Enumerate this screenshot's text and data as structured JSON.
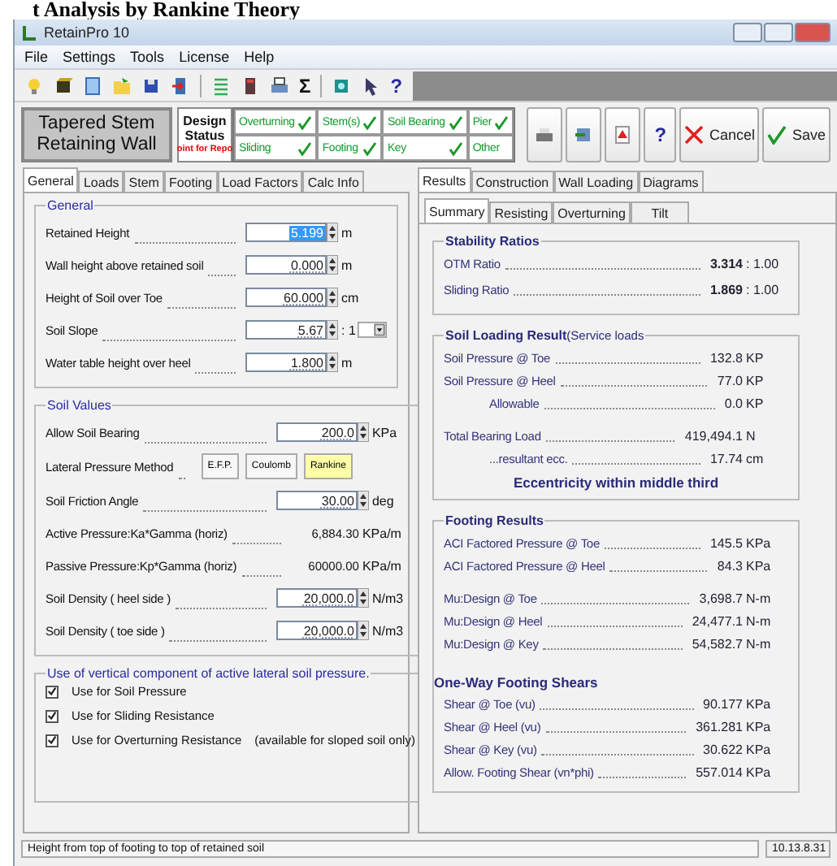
{
  "heading": "t Analysis by Rankine Theory",
  "window": {
    "title": "RetainPro 10"
  },
  "menu": [
    "File",
    "Settings",
    "Tools",
    "License",
    "Help"
  ],
  "toolbar": [
    {
      "kind": "bulb"
    },
    {
      "kind": "box"
    },
    {
      "kind": "doc"
    },
    {
      "kind": "folder"
    },
    {
      "kind": "save"
    },
    {
      "kind": "exit"
    },
    {
      "kind": "sep"
    },
    {
      "kind": "list"
    },
    {
      "kind": "calc"
    },
    {
      "kind": "print"
    },
    {
      "kind": "glyph",
      "text": "Σ"
    },
    {
      "kind": "sep"
    },
    {
      "kind": "book"
    },
    {
      "kind": "pointer"
    },
    {
      "kind": "glyph",
      "text": "?"
    }
  ],
  "wall_type": [
    "Tapered Stem",
    "Retaining Wall"
  ],
  "design_status": {
    "lines": [
      "Design",
      "Status"
    ],
    "note": "oint for Repo"
  },
  "status_checks": [
    {
      "label": "Overturning",
      "ok": true
    },
    {
      "label": "Stem(s)",
      "ok": true
    },
    {
      "label": "Soil Bearing",
      "ok": true
    },
    {
      "label": "Pier",
      "ok": true
    },
    {
      "label": "Sliding",
      "ok": true
    },
    {
      "label": "Footing",
      "ok": true
    },
    {
      "label": "Key",
      "ok": true
    },
    {
      "label": "Other",
      "ok": false
    }
  ],
  "actions": [
    {
      "kind": "print"
    },
    {
      "kind": "export"
    },
    {
      "kind": "pdf"
    },
    {
      "kind": "help",
      "text": "?"
    },
    {
      "kind": "cancel",
      "text": "Cancel"
    },
    {
      "kind": "save",
      "text": "Save"
    }
  ],
  "left_tabs": [
    {
      "label": "General",
      "selected": true
    },
    {
      "label": "Loads",
      "selected": false
    },
    {
      "label": "Stem",
      "selected": false
    },
    {
      "label": "Footing",
      "selected": false
    },
    {
      "label": "Load Factors",
      "selected": false
    },
    {
      "label": "Calc Info",
      "selected": false
    }
  ],
  "general": {
    "title": "General",
    "rows": [
      {
        "kind": "spin",
        "label": "Retained Height",
        "value": "5.199",
        "unit": "m",
        "selected": true
      },
      {
        "kind": "spin",
        "label": "Wall height above retained soil",
        "value": "0.000",
        "unit": "m",
        "selected": false
      },
      {
        "kind": "spin",
        "label": "Height of Soil over Toe",
        "value": "60.000",
        "unit": "cm",
        "selected": false
      },
      {
        "kind": "slope",
        "label": "Soil Slope",
        "value": "5.67",
        "unit": ": 1",
        "selected": false
      },
      {
        "kind": "spin",
        "label": "Water table height over heel",
        "value": "1.800",
        "unit": "m",
        "selected": false
      }
    ]
  },
  "soil_values": {
    "title": "Soil Values",
    "rows": [
      {
        "kind": "spin",
        "label": "Allow Soil Bearing",
        "value": "200.0",
        "unit": "KPa",
        "selected": false
      },
      {
        "kind": "method",
        "label": "Lateral Pressure Method",
        "options": [
          {
            "label": "E.F.P.",
            "selected": false
          },
          {
            "label": "Coulomb",
            "selected": false
          },
          {
            "label": "Rankine",
            "selected": true
          }
        ]
      },
      {
        "kind": "spin",
        "label": "Soil Friction Angle",
        "value": "30.00",
        "unit": "deg",
        "selected": false
      },
      {
        "kind": "readonly",
        "label": "Active Pressure:Ka*Gamma (horiz)",
        "value": "6,884.30",
        "unit": "KPa/m"
      },
      {
        "kind": "readonly",
        "label": "Passive Pressure:Kp*Gamma (horiz)",
        "value": "60000.00",
        "unit": "KPa/m"
      },
      {
        "kind": "spin",
        "label": "Soil Density ( heel side )",
        "value": "20,000.0",
        "unit": "N/m3",
        "selected": false
      },
      {
        "kind": "spin",
        "label": "Soil Density ( toe side )",
        "value": "20,000.0",
        "unit": "N/m3",
        "selected": false
      }
    ]
  },
  "vertical_component": {
    "title": "Use of vertical component of active lateral soil pressure.",
    "options": [
      {
        "label": "Use for Soil Pressure",
        "checked": true
      },
      {
        "label": "Use for Sliding Resistance",
        "checked": true
      },
      {
        "label": "Use for Overturning Resistance",
        "note": "(available for sloped soil only)",
        "checked": true
      }
    ]
  },
  "right_tabs": [
    {
      "label": "Results",
      "selected": true
    },
    {
      "label": "Construction",
      "selected": false
    },
    {
      "label": "Wall Loading",
      "selected": false
    },
    {
      "label": "Diagrams",
      "selected": false
    }
  ],
  "sub_tabs": [
    {
      "label": "Summary",
      "selected": true
    },
    {
      "label": "Resisting",
      "selected": false
    },
    {
      "label": "Overturning",
      "selected": false
    },
    {
      "label": "Tilt",
      "selected": false
    }
  ],
  "stability_ratios": {
    "title": "Stability Ratios",
    "rows": [
      {
        "label": "OTM Ratio",
        "value": "3.314",
        "suffix": ": 1.00"
      },
      {
        "label": "Sliding Ratio",
        "value": "1.869",
        "suffix": ": 1.00"
      }
    ]
  },
  "soil_loading": {
    "title": "Soil Loading Result",
    "subtitle": "(Service loads",
    "blocks": [
      [
        {
          "label": "Soil Pressure @ Toe",
          "value": "132.8",
          "unit": "KP"
        },
        {
          "label": "Soil Pressure @ Heel",
          "value": "77.0",
          "unit": "KP",
          "children": [
            {
              "label": "Allowable",
              "value": "0.0",
              "unit": "KP"
            }
          ]
        }
      ],
      [
        {
          "label": "Total Bearing Load",
          "value": "419,494.1",
          "unit": "N",
          "children": [
            {
              "label": "...resultant ecc.",
              "value": "17.74",
              "unit": "cm"
            }
          ]
        }
      ]
    ],
    "note": "Eccentricity within middle third"
  },
  "footing_results": {
    "title": "Footing Results",
    "blocks": [
      [
        {
          "label": "ACI Factored Pressure @ Toe",
          "value": "145.5",
          "unit": "KPa"
        },
        {
          "label": "ACI Factored Pressure @ Heel",
          "value": "84.3",
          "unit": "KPa"
        }
      ],
      [
        {
          "label": "Mu:Design @ Toe",
          "value": "3,698.7",
          "unit": "N-m"
        },
        {
          "label": "Mu:Design @ Heel",
          "value": "24,477.1",
          "unit": "N-m"
        },
        {
          "label": "Mu:Design @ Key",
          "value": "54,582.7",
          "unit": "N-m"
        }
      ]
    ],
    "shears_title": "One-Way Footing Shears",
    "shears": [
      {
        "label": "Shear @ Toe (vu)",
        "value": "90.177",
        "unit": "KPa"
      },
      {
        "label": "Shear @ Heel (vu)",
        "value": "361.281",
        "unit": "KPa"
      },
      {
        "label": "Shear @ Key (vu)",
        "value": "30.622",
        "unit": "KPa"
      },
      {
        "label": "Allow. Footing Shear (vn*phi)",
        "value": "557.014",
        "unit": "KPa"
      }
    ]
  },
  "status_bar": {
    "hint": "Height from top of footing to top of retained soil",
    "version": "10.13.8.31"
  }
}
